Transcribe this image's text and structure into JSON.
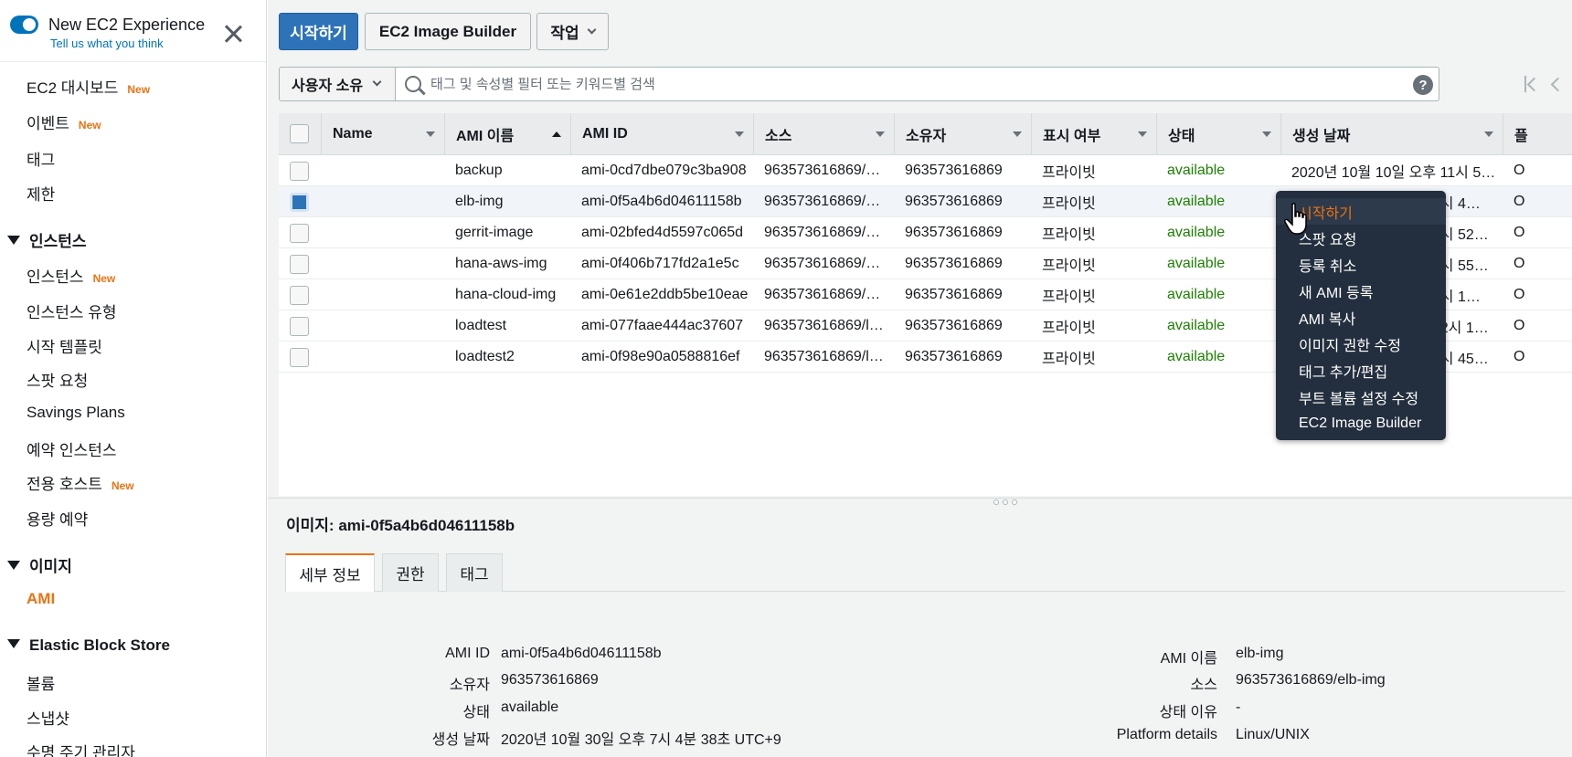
{
  "sidebar": {
    "experience_title": "New EC2 Experience",
    "experience_subtitle": "Tell us what you think",
    "new_badge": "New",
    "items": {
      "dashboard": "EC2 대시보드",
      "events": "이벤트",
      "tags": "태그",
      "limits": "제한",
      "instances": "인스턴스",
      "instance_types": "인스턴스 유형",
      "launch_templates": "시작 템플릿",
      "spot_requests": "스팟 요청",
      "savings_plans": "Savings Plans",
      "reserved_instances": "예약 인스턴스",
      "dedicated_hosts": "전용 호스트",
      "capacity_reservations": "용량 예약",
      "ami": "AMI",
      "volumes": "볼륨",
      "snapshots": "스냅샷",
      "lifecycle_manager": "수명 주기 관리자"
    },
    "sections": {
      "instances": "인스턴스",
      "images": "이미지",
      "ebs": "Elastic Block Store"
    }
  },
  "toolbar": {
    "launch_label": "시작하기",
    "image_builder_label": "EC2 Image Builder",
    "actions_label": "작업"
  },
  "filter": {
    "owner_label": "사용자 소유",
    "search_placeholder": "태그 및 속성별 필터 또는 키워드별 검색",
    "help": "?"
  },
  "table": {
    "columns": [
      "Name",
      "AMI 이름",
      "AMI ID",
      "소스",
      "소유자",
      "표시 여부",
      "상태",
      "생성 날짜",
      "플"
    ],
    "rows": [
      {
        "name": "",
        "ami_name": "backup",
        "ami_id": "ami-0cd7dbe079c3ba908",
        "source": "963573616869/…",
        "owner": "963573616869",
        "visibility": "프라이빗",
        "status": "available",
        "created": "2020년 10월 10일 오후 11시 5…",
        "platform": "O"
      },
      {
        "name": "",
        "ami_name": "elb-img",
        "ami_id": "ami-0f5a4b6d04611158b",
        "source": "963573616869/…",
        "owner": "963573616869",
        "visibility": "프라이빗",
        "status": "available",
        "created": "오후 7시 4…",
        "platform": "O"
      },
      {
        "name": "",
        "ami_name": "gerrit-image",
        "ami_id": "ami-02bfed4d5597c065d",
        "source": "963573616869/…",
        "owner": "963573616869",
        "visibility": "프라이빗",
        "status": "available",
        "created": "오전 9시 52…",
        "platform": "O"
      },
      {
        "name": "",
        "ami_name": "hana-aws-img",
        "ami_id": "ami-0f406b717fd2a1e5c",
        "source": "963573616869/…",
        "owner": "963573616869",
        "visibility": "프라이빗",
        "status": "available",
        "created": "오후 4시 55…",
        "platform": "O"
      },
      {
        "name": "",
        "ami_name": "hana-cloud-img",
        "ami_id": "ami-0e61e2ddb5be10eae",
        "source": "963573616869/…",
        "owner": "963573616869",
        "visibility": "프라이빗",
        "status": "available",
        "created": "오후 4시 1…",
        "platform": "O"
      },
      {
        "name": "",
        "ami_name": "loadtest",
        "ami_id": "ami-077faae444ac37607",
        "source": "963573616869/l…",
        "owner": "963573616869",
        "visibility": "프라이빗",
        "status": "available",
        "created": "오후 12시 1…",
        "platform": "O"
      },
      {
        "name": "",
        "ami_name": "loadtest2",
        "ami_id": "ami-0f98e90a0588816ef",
        "source": "963573616869/l…",
        "owner": "963573616869",
        "visibility": "프라이빗",
        "status": "available",
        "created": "오후 4시 45…",
        "platform": "O"
      }
    ]
  },
  "context_menu": {
    "items": [
      "시작하기",
      "스팟 요청",
      "등록 취소",
      "새 AMI 등록",
      "AMI 복사",
      "이미지 권한 수정",
      "태그 추가/편집",
      "부트 볼륨 설정 수정",
      "EC2 Image Builder"
    ]
  },
  "details": {
    "title_label": "이미지:",
    "title_value": "ami-0f5a4b6d04611158b",
    "tabs": [
      "세부 정보",
      "권한",
      "태그"
    ],
    "left": [
      {
        "label": "AMI ID",
        "value": "ami-0f5a4b6d04611158b"
      },
      {
        "label": "소유자",
        "value": "963573616869"
      },
      {
        "label": "상태",
        "value": "available"
      },
      {
        "label": "생성 날짜",
        "value": "2020년 10월 30일 오후 7시 4분 38초 UTC+9"
      }
    ],
    "right": [
      {
        "label": "AMI 이름",
        "value": "elb-img"
      },
      {
        "label": "소스",
        "value": "963573616869/elb-img"
      },
      {
        "label": "상태 이유",
        "value": "-"
      },
      {
        "label": "Platform details",
        "value": "Linux/UNIX"
      }
    ]
  },
  "colors": {
    "accent": "#ec7211",
    "primary_button": "#2e73b8",
    "available": "#1d8102",
    "menu_bg": "#232f3e"
  }
}
